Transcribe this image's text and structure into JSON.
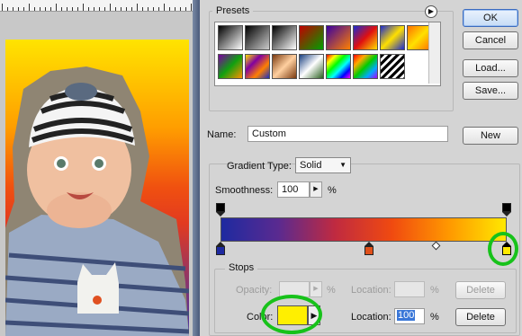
{
  "window_colors": {
    "accent_green": "#17c21a",
    "selected_field": "#3a77d8"
  },
  "presets": {
    "title": "Presets",
    "menu_icon": "circle-arrow-icon",
    "swatches": [
      {
        "name": "foreground-to-background",
        "css": "linear-gradient(135deg,#000,#fff)"
      },
      {
        "name": "foreground-to-transparent",
        "css": "linear-gradient(135deg,#000,#ccc)"
      },
      {
        "name": "black-white",
        "css": "linear-gradient(135deg,#000,#fff)"
      },
      {
        "name": "red-green",
        "css": "linear-gradient(135deg,#c00000,#00a000)"
      },
      {
        "name": "violet-orange",
        "css": "linear-gradient(135deg,#3a00a0,#ff8000)"
      },
      {
        "name": "blue-red-yellow",
        "css": "linear-gradient(135deg,#1a2ad0,#e01010,#ffe000)"
      },
      {
        "name": "blue-yellow-blue",
        "css": "linear-gradient(135deg,#1a2ad0,#ffe000,#1a2ad0)"
      },
      {
        "name": "orange-yellow-orange",
        "css": "linear-gradient(135deg,#ff7000,#ffe000,#ff7000)"
      },
      {
        "name": "violet-green-orange",
        "css": "linear-gradient(135deg,#7a00a0,#10a010,#ff9000)"
      },
      {
        "name": "yellow-violet-orange-blue",
        "css": "linear-gradient(135deg,#ffe000,#8000a0,#ff8000,#1a30c0)"
      },
      {
        "name": "copper",
        "css": "linear-gradient(135deg,#7a3a10,#ffd0a0,#7a3a10)"
      },
      {
        "name": "chrome",
        "css": "linear-gradient(135deg,#1a4080,#fff,#2a6020)"
      },
      {
        "name": "spectrum",
        "css": "linear-gradient(135deg,#f00,#ff0,#0f0,#0ff,#00f,#f0f)"
      },
      {
        "name": "transparent-rainbow",
        "css": "linear-gradient(135deg,#f00,#fa0,#0c0,#0af,#a0f)"
      },
      {
        "name": "transparent-stripes",
        "css": "repeating-linear-gradient(135deg,#000 0 3px,#fff 3px 6px)"
      }
    ]
  },
  "buttons": {
    "ok": "OK",
    "cancel": "Cancel",
    "load": "Load...",
    "save": "Save...",
    "new": "New"
  },
  "name_field": {
    "label": "Name:",
    "value": "Custom"
  },
  "gradient_type": {
    "label": "Gradient Type:",
    "value": "Solid"
  },
  "smoothness": {
    "label": "Smoothness:",
    "value": "100",
    "unit": "%"
  },
  "gradient_bar": {
    "css": "linear-gradient(90deg,#1e2aa0 0%,#5a2a90 20%,#c02a40 40%,#f04a10 60%,#ff9800 80%,#ffe800 100%)",
    "opacity_stops": [
      0,
      100
    ],
    "color_stops": [
      {
        "location": 0,
        "color": "#1e2aa0"
      },
      {
        "location": 52,
        "color": "#e0501a"
      },
      {
        "location": 100,
        "color": "#ffe800",
        "selected": true
      }
    ],
    "midpoint": 75
  },
  "stops": {
    "title": "Stops",
    "opacity_label": "Opacity:",
    "opacity_unit": "%",
    "opacity_location_label": "Location:",
    "opacity_location_unit": "%",
    "delete_label": "Delete",
    "color_label": "Color:",
    "color_value": "#ffef00",
    "color_location_label": "Location:",
    "color_location_value": "100",
    "color_location_unit": "%"
  }
}
